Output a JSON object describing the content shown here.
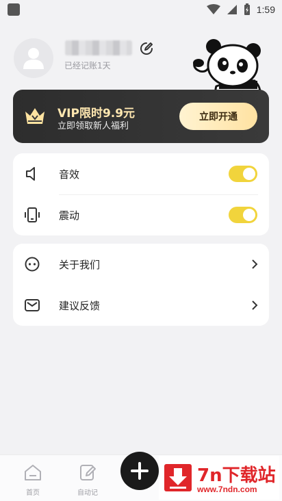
{
  "status_bar": {
    "time": "1:59"
  },
  "profile": {
    "days_label": "已经记账1天"
  },
  "vip": {
    "title": "VIP限时9.9元",
    "subtitle": "立即领取新人福利",
    "button_label": "立即开通"
  },
  "settings": [
    {
      "label": "音效",
      "icon": "speaker-icon",
      "toggle_on": true
    },
    {
      "label": "震动",
      "icon": "phone-vibrate-icon",
      "toggle_on": true
    }
  ],
  "links": [
    {
      "label": "关于我们",
      "icon": "face-icon"
    },
    {
      "label": "建议反馈",
      "icon": "mail-icon"
    }
  ],
  "nav": [
    {
      "label": "首页",
      "icon": "home-icon"
    },
    {
      "label": "自动记",
      "icon": "auto-record-icon"
    }
  ],
  "watermark": {
    "title": "7n下载站",
    "url": "www.7ndn.com"
  },
  "colors": {
    "accent_yellow": "#f1d43c",
    "vip_bg": "#2d2d2d",
    "watermark_red": "#e0262a"
  }
}
